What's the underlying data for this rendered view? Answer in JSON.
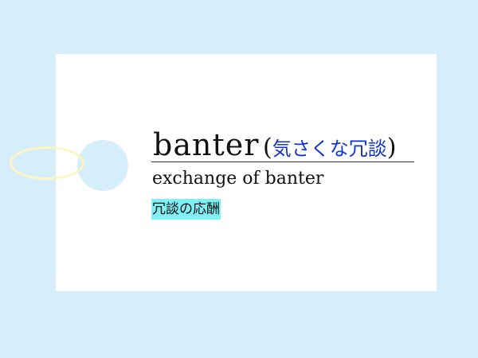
{
  "entry": {
    "headword": "banter",
    "paren_open": "(",
    "gloss": "気さくな冗談",
    "paren_close": ")",
    "example_en": "exchange of banter",
    "example_ja": "冗談の応酬"
  },
  "colors": {
    "background": "#d6eef9",
    "card": "#ffffff",
    "gloss": "#1133cc",
    "highlight": "#7ff0f6",
    "string": "#fbf6c4"
  }
}
